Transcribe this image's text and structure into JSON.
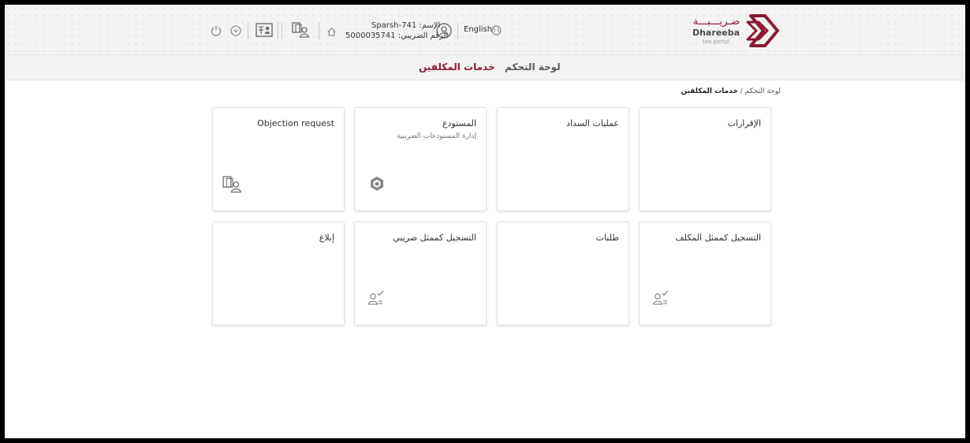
{
  "header": {
    "logo_ar": "ضـريـــبـــة",
    "logo_en": "Dhareeba",
    "logo_sub": "tax portal",
    "language_label": "English",
    "user_name_line": "الإسم: Sparsh-741",
    "user_tax_line": "الرقم الضريبي: 5000035741",
    "icons": [
      "globe-icon",
      "user-circle-icon",
      "home-icon",
      "switch-account-icon",
      "id-card-icon",
      "chevron-down-icon",
      "power-icon"
    ]
  },
  "nav": {
    "tabs": [
      {
        "label": "لوحة التحكم",
        "active": false
      },
      {
        "label": "خدمات المكلفين",
        "active": true
      }
    ]
  },
  "breadcrumb": {
    "root": "لوحة التحكم",
    "separator": "/",
    "current": "خدمات المكلفين"
  },
  "cards": [
    {
      "title": "الإقرارات",
      "subtitle": "",
      "icon": ""
    },
    {
      "title": "عمليات السداد",
      "subtitle": "",
      "icon": ""
    },
    {
      "title": "المستودع",
      "subtitle": "إدارة المستودعات الضريبية",
      "icon": "warehouse-cube-icon"
    },
    {
      "title": "Objection request",
      "subtitle": "",
      "icon": "switch-account-icon"
    },
    {
      "title": "التسجيل كممثل المكلف",
      "subtitle": "",
      "icon": "user-check-icon"
    },
    {
      "title": "طلبات",
      "subtitle": "",
      "icon": ""
    },
    {
      "title": "التسجيل كممثل ضريبي",
      "subtitle": "",
      "icon": "user-check-icon"
    },
    {
      "title": "إبلاغ",
      "subtitle": "",
      "icon": ""
    }
  ],
  "colors": {
    "brand": "#8b1a33",
    "header_bg": "#f3f3f3",
    "card_border": "#e2e2e2"
  }
}
